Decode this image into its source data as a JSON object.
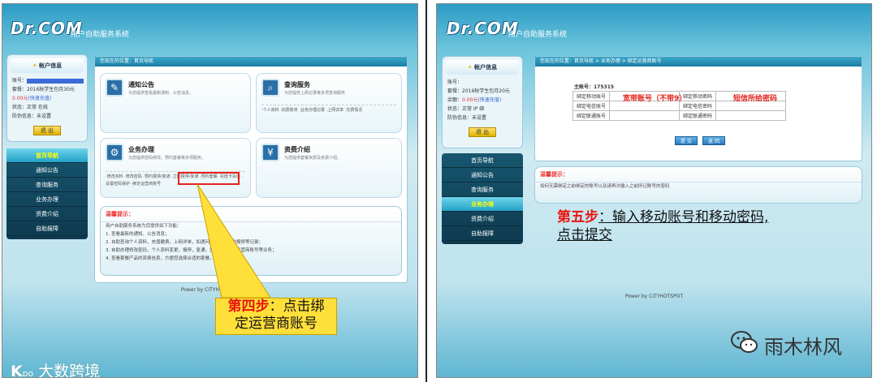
{
  "left": {
    "logo": "Dr.COM",
    "system_title": "用户自助服务系统",
    "account_card": {
      "title": "帐户信息",
      "rows": [
        {
          "label": "账号：",
          "value": ""
        },
        {
          "label": "套餐：",
          "value": "2016秋学生包月30元"
        },
        {
          "label": "",
          "value": "0.00元",
          "note": "(快速充值)"
        },
        {
          "label": "状态：",
          "value": "正常  在线"
        },
        {
          "label": "防伪信息：",
          "value": "未设置"
        }
      ],
      "exit_label": "退 出"
    },
    "nav": [
      "首页导航",
      "通知公告",
      "查询服务",
      "业务办理",
      "资费介绍",
      "自助报障"
    ],
    "nav_active_index": 0,
    "breadcrumb": "您现在的位置：首页导航",
    "services": [
      {
        "title": "通知公告",
        "desc": "为您提供查看最新通知、公告消息。",
        "icon": "pencil-icon",
        "links": ""
      },
      {
        "title": "查询服务",
        "desc": "为您提供上网记录等多项查询服务",
        "icon": "search-icon",
        "links": "·个人资料 ·扣费账单 ·业务办理记录 ·上网详单 ·交费情况"
      },
      {
        "title": "业务办理",
        "desc": "为您提供密码修改、预约套餐等多项服务。",
        "icon": "gear-icon",
        "links": "·修改资料 ·修改密码 ·预约报停/复通 ·立即报停/复通 ·预约套餐 ·充值卡充值 ·设置密码保护 ·绑定运营商账号"
      },
      {
        "title": "资费介绍",
        "desc": "为您提供套餐资费及资费介绍。",
        "icon": "yen-icon",
        "links": ""
      }
    ],
    "tips": {
      "title": "温馨提示：",
      "lines": [
        "用户自助服务系统为您提供如下功能：",
        "1. 查看最新的通知、公告消息；",
        "2. 自助查询个人资料，充值缴费，上网详单，如遇问题也可以自助报修等记录；",
        "3. 自助办理修改密码，个人资料变更，报停，复通，宽带账号绑定运营商账号等业务；",
        "4. 查看套餐产品的资费信息，方便您选择合适的套餐。"
      ]
    },
    "footer": "Power by CITYHOTSPOT",
    "callout": {
      "step": "第四步",
      "text1": "：点击绑",
      "text2": "定运营商账号"
    },
    "watermark": "大数跨境"
  },
  "right": {
    "logo": "Dr.COM",
    "system_title": "用户自助服务系统",
    "account_card": {
      "title": "帐户信息",
      "rows": [
        {
          "label": "账号：",
          "value": ""
        },
        {
          "label": "套餐：",
          "value": "2016秋学生包月20元"
        },
        {
          "label": "余额：",
          "value": "0.00元",
          "note": "(快速充值)"
        },
        {
          "label": "状态：",
          "value": "正常  IP 绑"
        },
        {
          "label": "防伪信息：",
          "value": "未设置"
        }
      ],
      "exit_label": "退 出"
    },
    "nav": [
      "首页导航",
      "通知公告",
      "查询服务",
      "业务办理",
      "资费介绍",
      "自助报障"
    ],
    "nav_active_index": 3,
    "breadcrumb": "您现在的位置：首页导航 > 业务办理 > 绑定运营商账号",
    "main_account_label": "主账号：175315",
    "table_rows": [
      [
        "绑定移动账号",
        "",
        "绑定移动密码",
        ""
      ],
      [
        "绑定电信账号",
        "",
        "绑定电信密码",
        ""
      ],
      [
        "绑定联通账号",
        "",
        "绑定联通密码",
        ""
      ]
    ],
    "annot_account": "宽带账号（不带9）",
    "annot_password": "短信所给密码",
    "submit_label": "提 交",
    "back_label": "返 回",
    "tips": {
      "title": "温馨提示：",
      "lines": [
        "如何无需绑定之前绑定的账号以及请再次输入之前所记账号的密码"
      ]
    },
    "footer": "Power by CITYHOTSPOT",
    "step5": {
      "step": "第五步",
      "line1": "：输入移动账号和移动密码,",
      "line2": "点击提交"
    },
    "watermark": "雨木林风"
  }
}
